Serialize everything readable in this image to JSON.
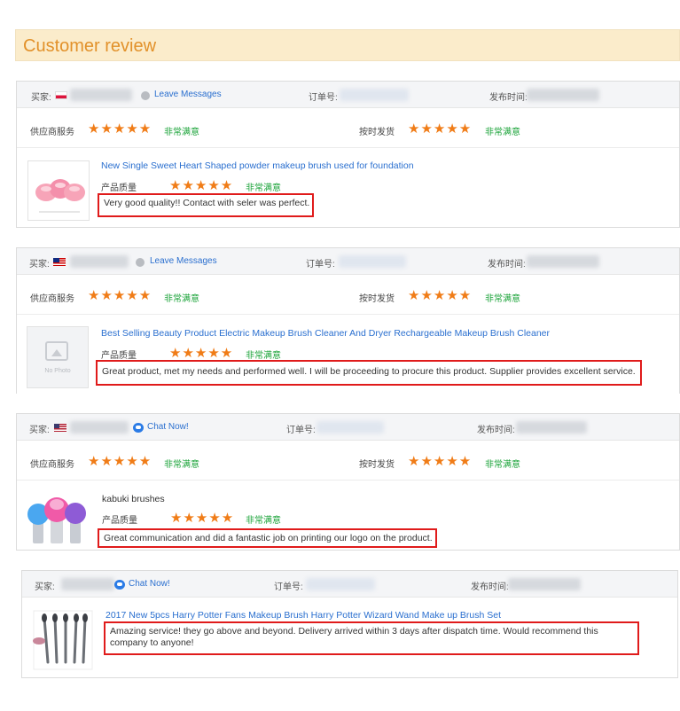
{
  "page": {
    "title": "Customer review"
  },
  "labels": {
    "buyer": "买家:",
    "order_no": "订单号:",
    "post_time": "发布时间:",
    "supplier_service": "供应商服务",
    "on_time_delivery": "按时发货",
    "product_quality": "产品质量",
    "very_satisfied": "非常满意",
    "stars": "★★★★★"
  },
  "colors": {
    "star": "#f07c17",
    "satisfied": "#1aa338",
    "link": "#2a6fcf",
    "highlight": "#e01b1b",
    "title_bg": "#fbeccb",
    "title_text": "#e2912a"
  },
  "reviews": [
    {
      "flag": "poland",
      "contact_label": "Leave Messages",
      "contact_icon": "message-icon",
      "supplier_rating": 5,
      "delivery_rating": 5,
      "product_rating": 5,
      "product_title": "New Single Sweet Heart Shaped powder makeup brush used for foundation",
      "review": "Very good quality!! Contact with seler was perfect."
    },
    {
      "flag": "malaysia",
      "contact_label": "Leave Messages",
      "contact_icon": "message-icon",
      "supplier_rating": 5,
      "delivery_rating": 5,
      "product_rating": 5,
      "thumb_text": "No Photo",
      "product_title": "Best Selling Beauty Product Electric Makeup Brush Cleaner And Dryer Rechargeable Makeup Brush Cleaner",
      "review": "Great product, met my needs and performed well. I will be proceeding to procure this product. Supplier provides excellent service."
    },
    {
      "flag": "usa",
      "contact_label": "Chat Now!",
      "contact_icon": "chat-icon",
      "supplier_rating": 5,
      "delivery_rating": 5,
      "product_rating": 5,
      "product_title": "kabuki brushes",
      "review": "Great communication and did a fantastic job on printing our logo on the product."
    },
    {
      "contact_label": "Chat Now!",
      "contact_icon": "chat-icon",
      "product_title": "2017 New 5pcs Harry Potter Fans Makeup Brush Harry Potter Wizard Wand Make up Brush Set",
      "review": "Amazing service! they go above and beyond. Delivery arrived within 3 days after dispatch time.  Would recommend this company to anyone!"
    }
  ]
}
